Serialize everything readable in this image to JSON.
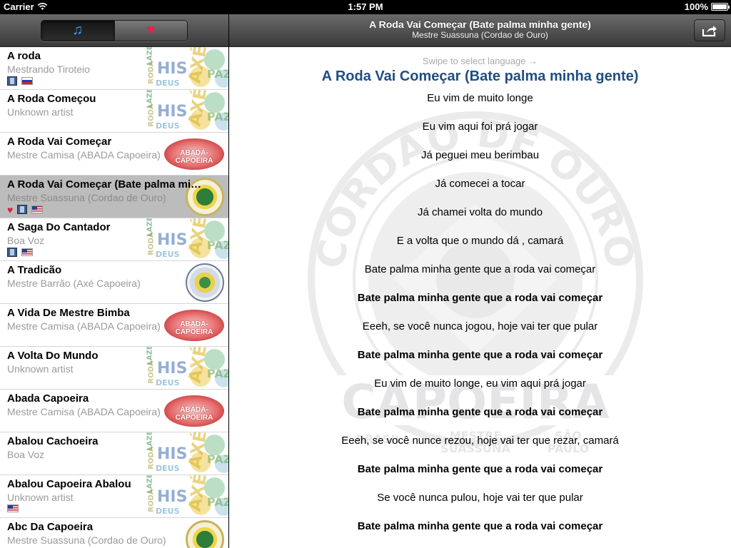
{
  "status": {
    "carrier": "Carrier",
    "time": "1:57 PM",
    "battery": "100%",
    "battery_level": 1.0
  },
  "left": {
    "tabs": [
      {
        "icon": "music-note-icon",
        "glyph": "♫",
        "selected": true
      },
      {
        "icon": "heart-icon",
        "glyph": "♥",
        "selected": false
      }
    ],
    "songs": [
      {
        "title": "A roda",
        "artist": "Mestrando Tiroteio",
        "badges": [
          "film",
          "flag-ru"
        ],
        "thumb": "words"
      },
      {
        "title": "A Roda Começou",
        "artist": "Unknown artist",
        "badges": [],
        "thumb": "words"
      },
      {
        "title": "A Roda Vai Começar",
        "artist": "Mestre Camisa (ABADA Capoeira)",
        "badges": [],
        "thumb": "abada"
      },
      {
        "title": "A Roda Vai Começar (Bate palma minha gente)",
        "artist": "Mestre Suassuna (Cordao de Ouro)",
        "badges": [
          "heart",
          "film",
          "flag-us"
        ],
        "thumb": "seal",
        "selected": true
      },
      {
        "title": "A Saga Do Cantador",
        "artist": "Boa Voz",
        "badges": [
          "film",
          "flag-us"
        ],
        "thumb": "words"
      },
      {
        "title": "A Tradicão",
        "artist": "Mestre Barrão (Axé Capoeira)",
        "badges": [],
        "thumb": "axe"
      },
      {
        "title": "A Vida De Mestre Bimba",
        "artist": "Mestre Camisa (ABADA Capoeira)",
        "badges": [],
        "thumb": "abada"
      },
      {
        "title": "A Volta Do Mundo",
        "artist": "Unknown artist",
        "badges": [],
        "thumb": "words"
      },
      {
        "title": "Abada Capoeira",
        "artist": "Mestre Camisa (ABADA Capoeira)",
        "badges": [],
        "thumb": "abada"
      },
      {
        "title": "Abalou Cachoeira",
        "artist": "Boa Voz",
        "badges": [],
        "thumb": "words"
      },
      {
        "title": "Abalou Capoeira Abalou",
        "artist": "Unknown artist",
        "badges": [
          "flag-us"
        ],
        "thumb": "words"
      },
      {
        "title": "Abc Da Capoeira",
        "artist": "Mestre Suassuna (Cordao de Ouro)",
        "badges": [],
        "thumb": "seal"
      }
    ],
    "thumb_words": [
      "LAZER",
      "HIS",
      "AXÉ",
      "DEUS",
      "PAZ",
      "RODA"
    ],
    "abada_label": "ABADÁ-CAPOEIRA"
  },
  "right": {
    "toolbar_title": "A Roda Vai Começar (Bate palma minha gente)",
    "toolbar_subtitle": "Mestre Suassuna (Cordao de Ouro)",
    "share_icon": "share-icon",
    "swipe_hint": "Swipe to select language →",
    "song_title": "A Roda Vai Começar (Bate palma minha gente)",
    "watermark": {
      "top_text": "CORDÃO DE OURO",
      "bottom_text": "CAPOEIRA",
      "left_small": "BRASIL",
      "mid_small": "MESTRE",
      "mid_small2": "SUASSUNA",
      "right_small": "SÃO",
      "right_small2": "PAULO"
    },
    "lyrics": [
      {
        "text": "Eu vim de muito longe",
        "bold": false
      },
      {
        "text": "Eu vim aqui foi prá jogar",
        "bold": false
      },
      {
        "text": "Já peguei meu berimbau",
        "bold": false
      },
      {
        "text": "Já comecei a tocar",
        "bold": false
      },
      {
        "text": "Já chamei volta do mundo",
        "bold": false
      },
      {
        "text": "E a volta que o mundo dá , camará",
        "bold": false
      },
      {
        "text": "Bate palma minha gente que a roda vai começar",
        "bold": false
      },
      {
        "text": "Bate palma minha gente que a roda vai começar",
        "bold": true
      },
      {
        "text": "Eeeh, se você nunca jogou, hoje vai ter que pular",
        "bold": false
      },
      {
        "text": "Bate palma minha gente que a roda vai começar",
        "bold": true
      },
      {
        "text": "Eu vim de muito longe, eu vim aqui prá jogar",
        "bold": false
      },
      {
        "text": "Bate palma minha gente que a roda vai começar",
        "bold": true
      },
      {
        "text": "Eeeh, se você nunce rezou, hoje vai ter que rezar, camará",
        "bold": false
      },
      {
        "text": "Bate palma minha gente que a roda vai começar",
        "bold": true
      },
      {
        "text": "Se você nunca pulou, hoje vai ter que pular",
        "bold": false
      },
      {
        "text": "Bate palma minha gente que a roda vai começar",
        "bold": true
      }
    ]
  },
  "colors": {
    "heading_blue": "#1e4e82",
    "accent_blue": "#3aa0ff",
    "heart_red": "#e8204a",
    "selected_row": "#bcbcbc"
  }
}
